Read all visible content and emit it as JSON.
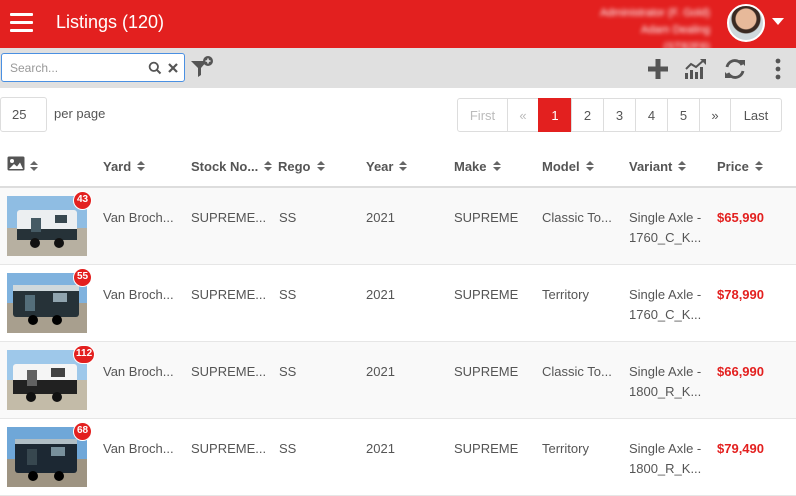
{
  "header": {
    "title": "Listings (120)",
    "user_line1": "Administrator (F. Gold)",
    "user_line2": "Adam Dealing (ST82F6)",
    "colors": {
      "brand": "#e3201f"
    }
  },
  "toolbar": {
    "search_placeholder": "Search...",
    "icons": [
      "search-icon",
      "clear-icon",
      "filter-add-icon",
      "add-icon",
      "stats-icon",
      "refresh-icon",
      "more-vertical-icon"
    ]
  },
  "pagination": {
    "per_page_value": "25",
    "per_page_label": "per page",
    "first": "First",
    "prev": "«",
    "pages": [
      "1",
      "2",
      "3",
      "4",
      "5"
    ],
    "active_page": "1",
    "next": "»",
    "last": "Last"
  },
  "table": {
    "columns": [
      "Yard",
      "Stock No...",
      "Rego",
      "Year",
      "Make",
      "Model",
      "Variant",
      "Price"
    ],
    "rows": [
      {
        "photos": "43",
        "yard": "Van Broch...",
        "stock": "SUPREME...",
        "rego": "SS",
        "year": "2021",
        "make": "SUPREME",
        "model": "Classic To...",
        "variant1": "Single Axle -",
        "variant2": "1760_C_K...",
        "price": "$65,990"
      },
      {
        "photos": "55",
        "yard": "Van Broch...",
        "stock": "SUPREME...",
        "rego": "SS",
        "year": "2021",
        "make": "SUPREME",
        "model": "Territory",
        "variant1": "Single Axle -",
        "variant2": "1760_C_K...",
        "price": "$78,990"
      },
      {
        "photos": "112",
        "yard": "Van Broch...",
        "stock": "SUPREME...",
        "rego": "SS",
        "year": "2021",
        "make": "SUPREME",
        "model": "Classic To...",
        "variant1": "Single Axle -",
        "variant2": "1800_R_K...",
        "price": "$66,990"
      },
      {
        "photos": "68",
        "yard": "Van Broch...",
        "stock": "SUPREME...",
        "rego": "SS",
        "year": "2021",
        "make": "SUPREME",
        "model": "Territory",
        "variant1": "Single Axle -",
        "variant2": "1800_R_K...",
        "price": "$79,490"
      }
    ]
  }
}
